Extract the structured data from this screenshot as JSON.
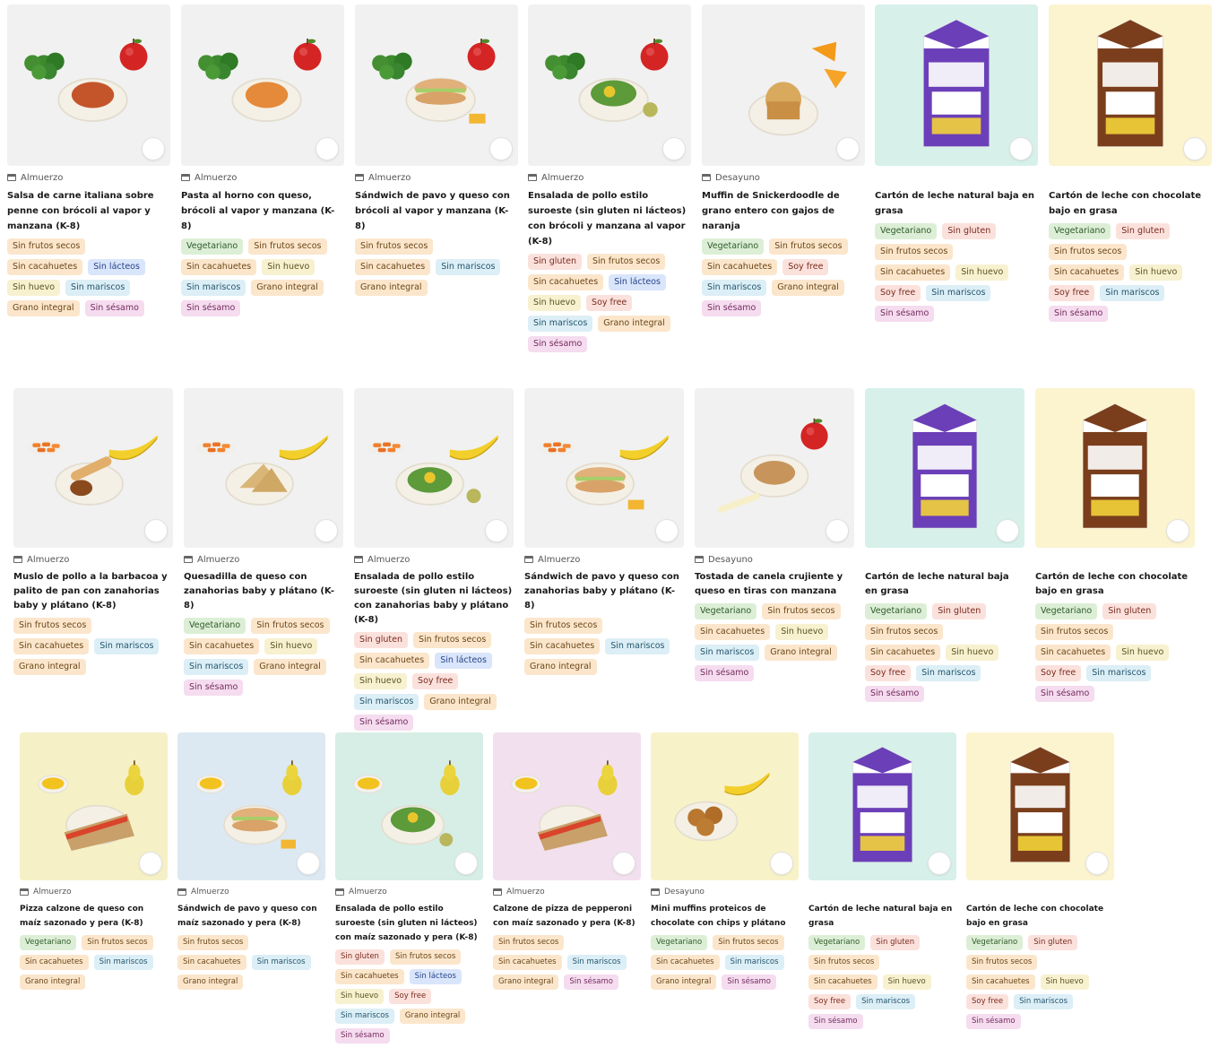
{
  "icons": {
    "lunch": "tray-icon",
    "breakfast": "coffee-icon"
  },
  "colors": {
    "milk_purple": "#6b3fb8",
    "milk_brown": "#7a3e1c",
    "apple_red": "#d42424",
    "broccoli_green": "#3d8a2e",
    "banana_yellow": "#f2cf2a"
  },
  "rows": [
    {
      "items": [
        {
          "meal": "Almuerzo",
          "title": "Salsa de carne italiana sobre penne con brócoli al vapor y manzana (K-8)",
          "tags": [
            "Sin frutos secos",
            "Sin cacahuetes",
            "Sin lácteos",
            "Sin huevo",
            "Sin mariscos",
            "Grano integral",
            "Sin sésamo"
          ]
        },
        {
          "meal": "Almuerzo",
          "title": "Pasta al horno con queso, brócoli al vapor y manzana (K-8)",
          "tags": [
            "Vegetariano",
            "Sin frutos secos",
            "Sin cacahuetes",
            "Sin huevo",
            "Sin mariscos",
            "Grano integral",
            "Sin sésamo"
          ]
        },
        {
          "meal": "Almuerzo",
          "title": "Sándwich de pavo y queso con brócoli al vapor y manzana (K-8)",
          "tags": [
            "Sin frutos secos",
            "Sin cacahuetes",
            "Sin mariscos",
            "Grano integral"
          ]
        },
        {
          "meal": "Almuerzo",
          "title": "Ensalada de pollo estilo suroeste (sin gluten ni lácteos) con brócoli y manzana al vapor (K-8)",
          "tags": [
            "Sin gluten",
            "Sin frutos secos",
            "Sin cacahuetes",
            "Sin lácteos",
            "Sin huevo",
            "Soy free",
            "Sin mariscos",
            "Grano integral",
            "Sin sésamo"
          ]
        },
        {
          "meal": "Desayuno",
          "title": "Muffin de Snickerdoodle de grano entero con gajos de naranja",
          "tags": [
            "Vegetariano",
            "Sin frutos secos",
            "Sin cacahuetes",
            "Soy free",
            "Sin mariscos",
            "Grano integral",
            "Sin sésamo"
          ]
        },
        {
          "meal": "",
          "title": "Cartón de leche natural baja en grasa",
          "tags": [
            "Vegetariano",
            "Sin gluten",
            "Sin frutos secos",
            "Sin cacahuetes",
            "Sin huevo",
            "Soy free",
            "Sin mariscos",
            "Sin sésamo"
          ]
        },
        {
          "meal": "",
          "title": "Cartón de leche con chocolate bajo en grasa",
          "tags": [
            "Vegetariano",
            "Sin gluten",
            "Sin frutos secos",
            "Sin cacahuetes",
            "Sin huevo",
            "Soy free",
            "Sin mariscos",
            "Sin sésamo"
          ]
        }
      ]
    },
    {
      "items": [
        {
          "meal": "Almuerzo",
          "title": "Muslo de pollo a la barbacoa y palito de pan con zanahorias baby y plátano (K-8)",
          "tags": [
            "Sin frutos secos",
            "Sin cacahuetes",
            "Sin mariscos",
            "Grano integral"
          ]
        },
        {
          "meal": "Almuerzo",
          "title": "Quesadilla de queso con zanahorias baby y plátano (K-8)",
          "tags": [
            "Vegetariano",
            "Sin frutos secos",
            "Sin cacahuetes",
            "Sin huevo",
            "Sin mariscos",
            "Grano integral",
            "Sin sésamo"
          ]
        },
        {
          "meal": "Almuerzo",
          "title": "Ensalada de pollo estilo suroeste (sin gluten ni lácteos) con zanahorias baby y plátano (K-8)",
          "tags": [
            "Sin gluten",
            "Sin frutos secos",
            "Sin cacahuetes",
            "Sin lácteos",
            "Sin huevo",
            "Soy free",
            "Sin mariscos",
            "Grano integral",
            "Sin sésamo"
          ]
        },
        {
          "meal": "Almuerzo",
          "title": "Sándwich de pavo y queso con zanahorias baby y plátano (K-8)",
          "tags": [
            "Sin frutos secos",
            "Sin cacahuetes",
            "Sin mariscos",
            "Grano integral"
          ]
        },
        {
          "meal": "Desayuno",
          "title": "Tostada de canela crujiente y queso en tiras con manzana",
          "tags": [
            "Vegetariano",
            "Sin frutos secos",
            "Sin cacahuetes",
            "Sin huevo",
            "Sin mariscos",
            "Grano integral",
            "Sin sésamo"
          ]
        },
        {
          "meal": "",
          "title": "Cartón de leche natural baja en grasa",
          "tags": [
            "Vegetariano",
            "Sin gluten",
            "Sin frutos secos",
            "Sin cacahuetes",
            "Sin huevo",
            "Soy free",
            "Sin mariscos",
            "Sin sésamo"
          ]
        },
        {
          "meal": "",
          "title": "Cartón de leche con chocolate bajo en grasa",
          "tags": [
            "Vegetariano",
            "Sin gluten",
            "Sin frutos secos",
            "Sin cacahuetes",
            "Sin huevo",
            "Soy free",
            "Sin mariscos",
            "Sin sésamo"
          ]
        }
      ]
    },
    {
      "items": [
        {
          "meal": "Almuerzo",
          "title": "Pizza calzone de queso con maíz sazonado y pera (K-8)",
          "tags": [
            "Vegetariano",
            "Sin frutos secos",
            "Sin cacahuetes",
            "Sin mariscos",
            "Grano integral"
          ]
        },
        {
          "meal": "Almuerzo",
          "title": "Sándwich de pavo y queso con maíz sazonado y pera (K-8)",
          "tags": [
            "Sin frutos secos",
            "Sin cacahuetes",
            "Sin mariscos",
            "Grano integral"
          ]
        },
        {
          "meal": "Almuerzo",
          "title": "Ensalada de pollo estilo suroeste (sin gluten ni lácteos) con maíz sazonado y pera (K-8)",
          "tags": [
            "Sin gluten",
            "Sin frutos secos",
            "Sin cacahuetes",
            "Sin lácteos",
            "Sin huevo",
            "Soy free",
            "Sin mariscos",
            "Grano integral",
            "Sin sésamo"
          ]
        },
        {
          "meal": "Almuerzo",
          "title": "Calzone de pizza de pepperoni con maíz sazonado y pera (K-8)",
          "tags": [
            "Sin frutos secos",
            "Sin cacahuetes",
            "Sin mariscos",
            "Grano integral",
            "Sin sésamo"
          ]
        },
        {
          "meal": "Desayuno",
          "title": "Mini muffins proteicos de chocolate con chips y plátano",
          "tags": [
            "Vegetariano",
            "Sin frutos secos",
            "Sin cacahuetes",
            "Sin mariscos",
            "Grano integral",
            "Sin sésamo"
          ]
        },
        {
          "meal": "",
          "title": "Cartón de leche natural baja en grasa",
          "tags": [
            "Vegetariano",
            "Sin gluten",
            "Sin frutos secos",
            "Sin cacahuetes",
            "Sin huevo",
            "Soy free",
            "Sin mariscos",
            "Sin sésamo"
          ]
        },
        {
          "meal": "",
          "title": "Cartón de leche con chocolate bajo en grasa",
          "tags": [
            "Vegetariano",
            "Sin gluten",
            "Sin frutos secos",
            "Sin cacahuetes",
            "Sin huevo",
            "Soy free",
            "Sin mariscos",
            "Sin sésamo"
          ]
        }
      ]
    }
  ]
}
